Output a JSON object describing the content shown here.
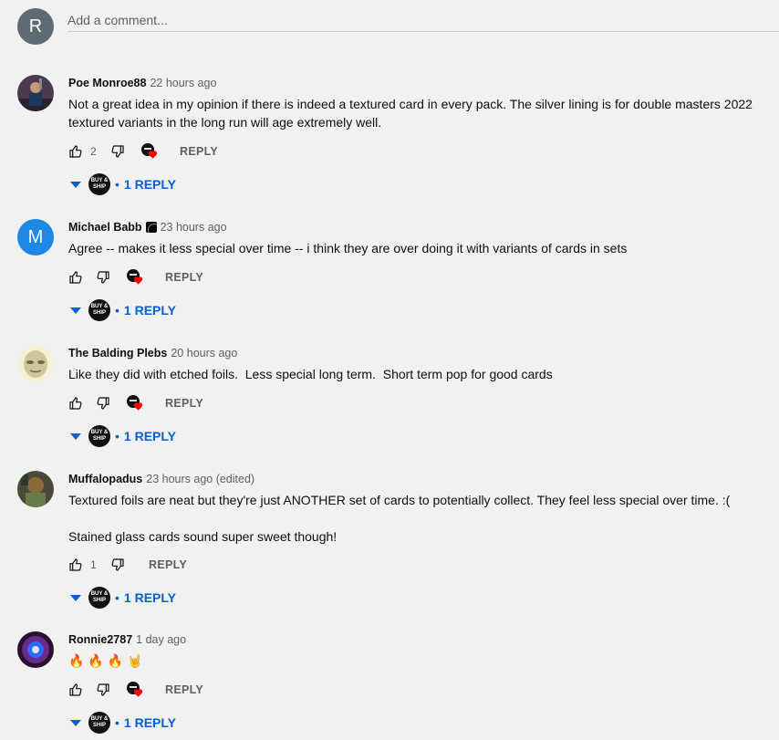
{
  "composer": {
    "avatar_letter": "R",
    "placeholder": "Add a comment..."
  },
  "colors": {
    "accent": "#065fd4",
    "heart": "#ff0000"
  },
  "comments": [
    {
      "author": "Poe Monroe88",
      "time": "22 hours ago",
      "text": [
        "Not a great idea in my opinion if there is indeed a textured card in every pack. The silver lining is for double masters 2022 textured variants in the long run will age extremely well."
      ],
      "likes": "2",
      "hearted": true,
      "reply_label": "REPLY",
      "replies_label": "1 REPLY"
    },
    {
      "author": "Michael Babb",
      "avatar_letter": "M",
      "time": "23 hours ago",
      "text": [
        "Agree -- makes it less special over time -- i think they are over doing it with variants of cards in sets"
      ],
      "likes": "",
      "hearted": true,
      "reply_label": "REPLY",
      "replies_label": "1 REPLY"
    },
    {
      "author": "The Balding Plebs",
      "time": "20 hours ago",
      "text": [
        "Like they did with etched foils.  Less special long term.  Short term pop for good cards"
      ],
      "likes": "",
      "hearted": true,
      "reply_label": "REPLY",
      "replies_label": "1 REPLY"
    },
    {
      "author": "Muffalopadus",
      "time": "23 hours ago (edited)",
      "text": [
        "Textured foils are neat but they're just ANOTHER set of cards to potentially collect. They feel less special over time. :(",
        "",
        "Stained glass cards sound super sweet though!"
      ],
      "likes": "1",
      "hearted": false,
      "reply_label": "REPLY",
      "replies_label": "1 REPLY"
    },
    {
      "author": "Ronnie2787",
      "time": "1 day ago",
      "text": [
        "🔥 🔥 🔥 🤘"
      ],
      "likes": "",
      "hearted": true,
      "reply_label": "REPLY",
      "replies_label": "1 REPLY"
    }
  ],
  "channel_avatar_text": [
    "BUY &",
    "SHIP"
  ]
}
